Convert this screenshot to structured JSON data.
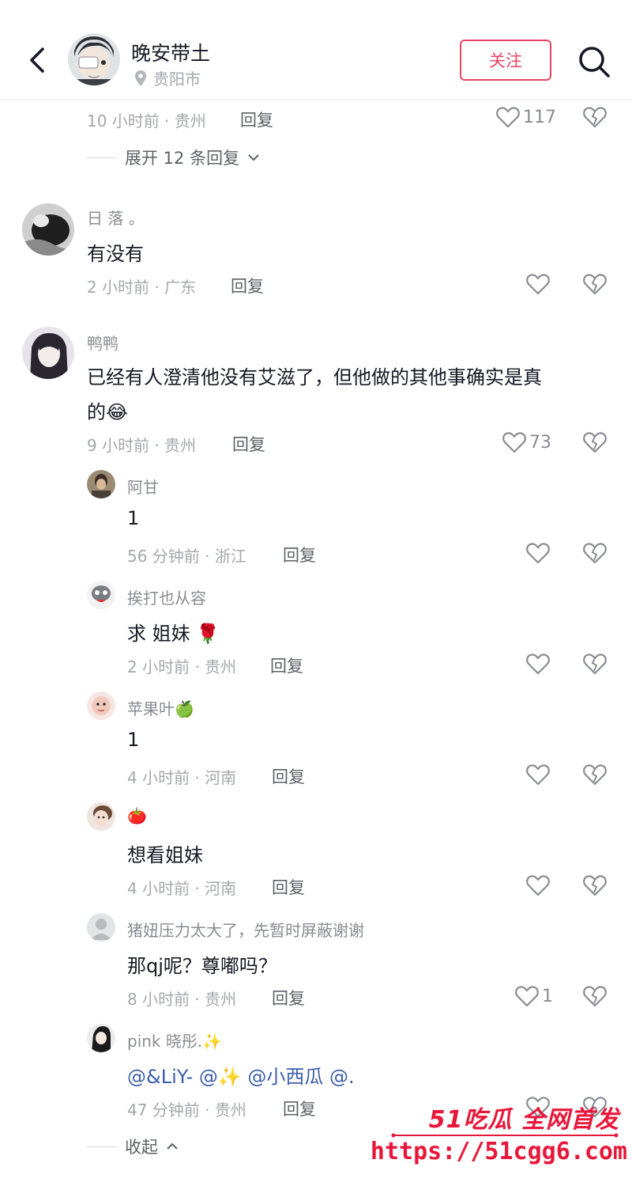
{
  "header": {
    "name": "晚安带土",
    "location": "贵阳市",
    "follow_label": "关注"
  },
  "top_meta": {
    "time_loc": "10 小时前 · 贵州",
    "reply": "回复",
    "likes": "117"
  },
  "expand_replies": "展开 12 条回复",
  "comments": [
    {
      "user": "日 落 。",
      "text": "有没有",
      "time_loc": "2 小时前 · 广东",
      "reply": "回复",
      "likes": ""
    },
    {
      "user": "鸭鸭",
      "text_line1": "已经有人澄清他没有艾滋了，但他做的其他事确实是真",
      "text_line2": "的😂",
      "time_loc": "9 小时前 · 贵州",
      "reply": "回复",
      "likes": "73"
    }
  ],
  "replies": [
    {
      "user": "阿甘",
      "text": "1",
      "time_loc": "56 分钟前 · 浙江",
      "reply": "回复",
      "likes": ""
    },
    {
      "user": "挨打也从容",
      "text": "求 姐妹 🌹",
      "time_loc": "2 小时前 · 贵州",
      "reply": "回复",
      "likes": ""
    },
    {
      "user": "苹果叶🍏",
      "text": "1",
      "time_loc": "4 小时前 · 河南",
      "reply": "回复",
      "likes": ""
    },
    {
      "user": "🍅",
      "text": "想看姐妹",
      "time_loc": "4 小时前 · 河南",
      "reply": "回复",
      "likes": ""
    },
    {
      "user": "猪妞压力太大了，先暂时屏蔽谢谢",
      "text": "那qj呢？尊嘟吗？",
      "time_loc": "8 小时前 · 贵州",
      "reply": "回复",
      "likes": "1"
    },
    {
      "user": "pink 晓彤.✨",
      "text_mentions": [
        "@&LiY- ",
        "@✨ ",
        "@小西瓜 ",
        "@."
      ],
      "time_loc": "47 分钟前 · 贵州",
      "reply": "回复",
      "likes": ""
    }
  ],
  "collapse": "收起",
  "watermark": {
    "top": "51吃瓜 全网首发",
    "url": "https://51cgg6.com"
  },
  "colors": {
    "accent": "#e94562",
    "muted": "#a6a7ab",
    "mention": "#3b5ea8",
    "watermark": "#e8173a"
  }
}
